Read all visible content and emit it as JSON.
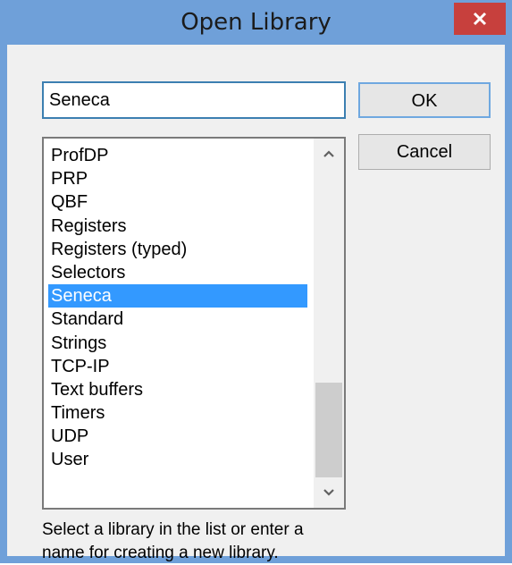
{
  "window": {
    "title": "Open Library",
    "close_glyph": "×"
  },
  "name_input": {
    "value": "Seneca"
  },
  "buttons": {
    "ok_label": "OK",
    "cancel_label": "Cancel"
  },
  "list": {
    "items": [
      "ProfDP",
      "PRP",
      "QBF",
      "Registers",
      "Registers (typed)",
      "Selectors",
      "Seneca",
      "Standard",
      "Strings",
      "TCP-IP",
      "Text buffers",
      "Timers",
      "UDP",
      "User"
    ],
    "selected_index": 6
  },
  "hint_text": "Select a library in the list or enter a name for creating a new library.",
  "icons": {
    "close": "close-icon",
    "scroll_up": "chevron-up-icon",
    "scroll_down": "chevron-down-icon"
  },
  "colors": {
    "window_frame": "#6fa0d9",
    "close_button": "#c7403d",
    "selection": "#3399ff",
    "input_focus_border": "#3c7fb1"
  }
}
